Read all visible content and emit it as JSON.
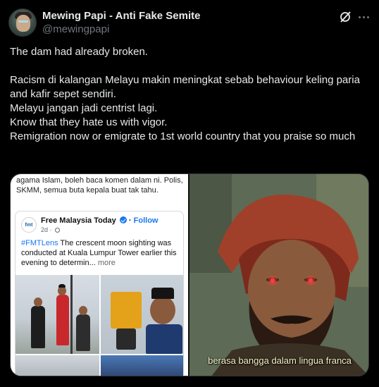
{
  "author": {
    "name": "Mewing Papi - Anti Fake Semite",
    "handle": "@mewingpapi"
  },
  "post": {
    "lines": [
      "The dam had already broken.",
      "",
      "Racism di kalangan Melayu makin meningkat sebab behaviour keling paria and kafir sepet sendiri.",
      "Melayu jangan jadi centrist lagi.",
      "Know that they hate us with vigor.",
      "Remigration now or emigrate to 1st world country that you praise so much"
    ]
  },
  "media": {
    "left": {
      "top_text": "agama Islam, boleh baca komen dalam ni. Polis, SKMM, semua buta kepala buat tak tahu.",
      "card": {
        "page_name": "Free Malaysia Today",
        "follow_label": "Follow",
        "time": "2d",
        "logo_text": "fmt",
        "tag": "#FMTLens",
        "caption": " The crescent moon sighting was conducted at Kuala Lumpur Tower earlier this evening to determin...",
        "more_label": "more"
      }
    },
    "right": {
      "subtitle": "berasa bangga dalam lingua franca"
    }
  },
  "icons": {
    "grok": "grok-icon",
    "more": "more-dots-icon",
    "verified": "verified-badge-icon",
    "globe": "globe-icon"
  },
  "colors": {
    "background": "#000000",
    "text": "#e7e9ea",
    "secondary": "#71767b",
    "facebook_blue": "#1877f2",
    "subtitle": "#f7f3c8"
  }
}
